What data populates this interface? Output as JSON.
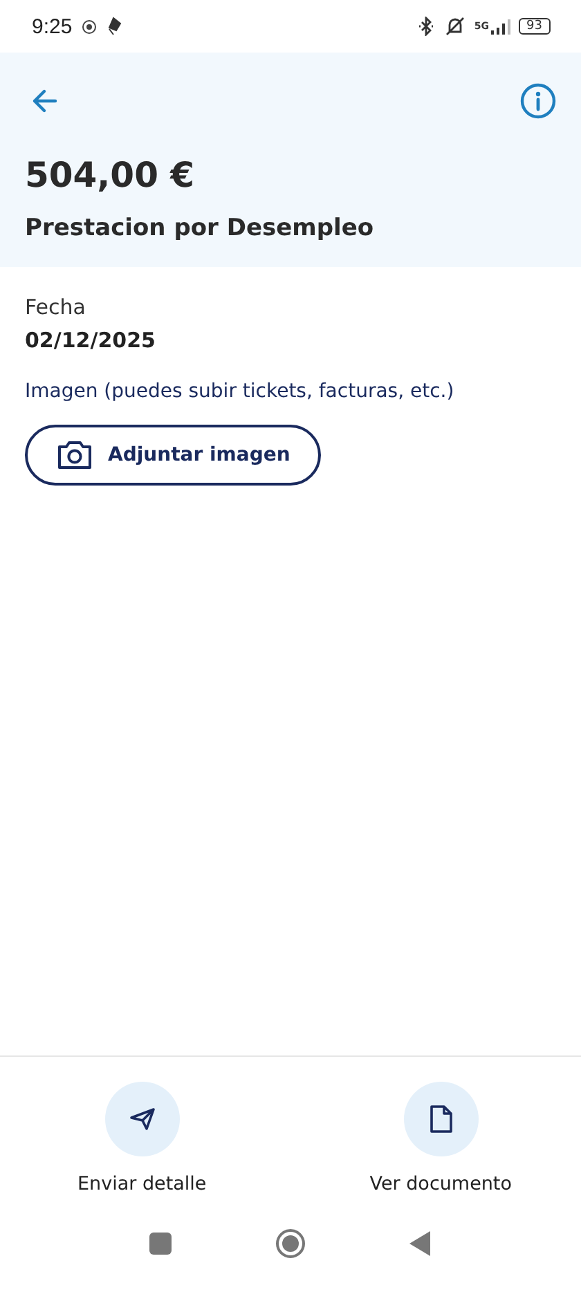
{
  "status_bar": {
    "time": "9:25",
    "network": "5G",
    "battery": "93"
  },
  "header": {
    "amount": "504,00 €",
    "title": "Prestacion por Desempleo"
  },
  "fields": [
    {
      "label": "Fecha",
      "value": "02/12/2025"
    }
  ],
  "attachment": {
    "label": "Imagen (puedes subir tickets, facturas, etc.)",
    "button": "Adjuntar imagen"
  },
  "actions": [
    {
      "kind": "send",
      "label": "Enviar detalle"
    },
    {
      "kind": "document",
      "label": "Ver documento"
    }
  ]
}
